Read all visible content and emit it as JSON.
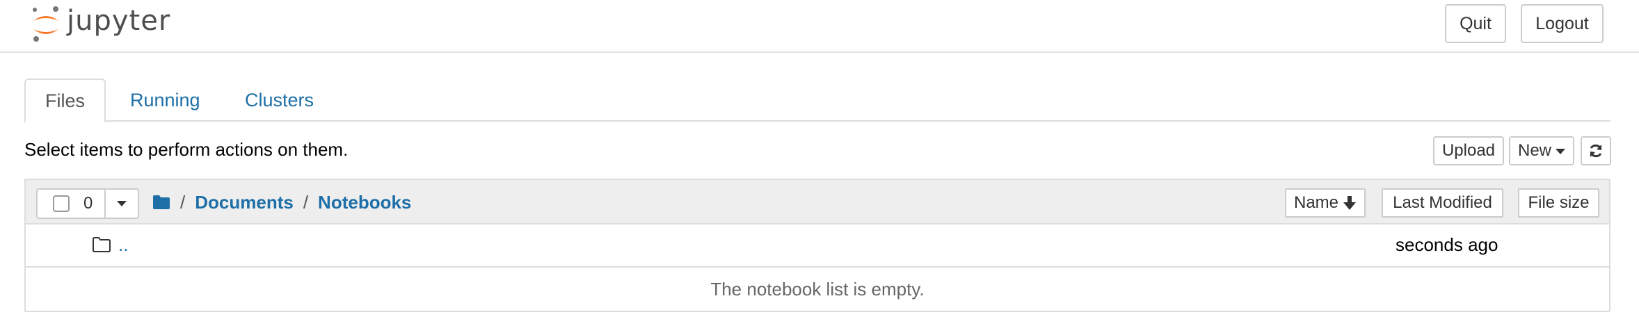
{
  "header": {
    "logo_text": "jupyter",
    "quit_label": "Quit",
    "logout_label": "Logout",
    "brand_colors": {
      "orange": "#F37726",
      "gray": "#767677"
    }
  },
  "tabs": [
    {
      "label": "Files",
      "active": true
    },
    {
      "label": "Running",
      "active": false
    },
    {
      "label": "Clusters",
      "active": false
    }
  ],
  "toolbar": {
    "message": "Select items to perform actions on them.",
    "upload_label": "Upload",
    "new_label": "New",
    "refresh_icon": "refresh-icon"
  },
  "list": {
    "selected_count": "0",
    "breadcrumb": {
      "root_icon": "folder-icon",
      "items": [
        "Documents",
        "Notebooks"
      ],
      "separator": "/"
    },
    "columns": {
      "name": "Name",
      "last_modified": "Last Modified",
      "file_size": "File size"
    },
    "rows": [
      {
        "name": "..",
        "modified": "seconds ago",
        "icon": "folder-outline-icon"
      }
    ],
    "empty_message": "The notebook list is empty."
  },
  "colors": {
    "link": "#1e6fa8",
    "header_bg": "#eeeeee",
    "border": "#dddddd"
  }
}
